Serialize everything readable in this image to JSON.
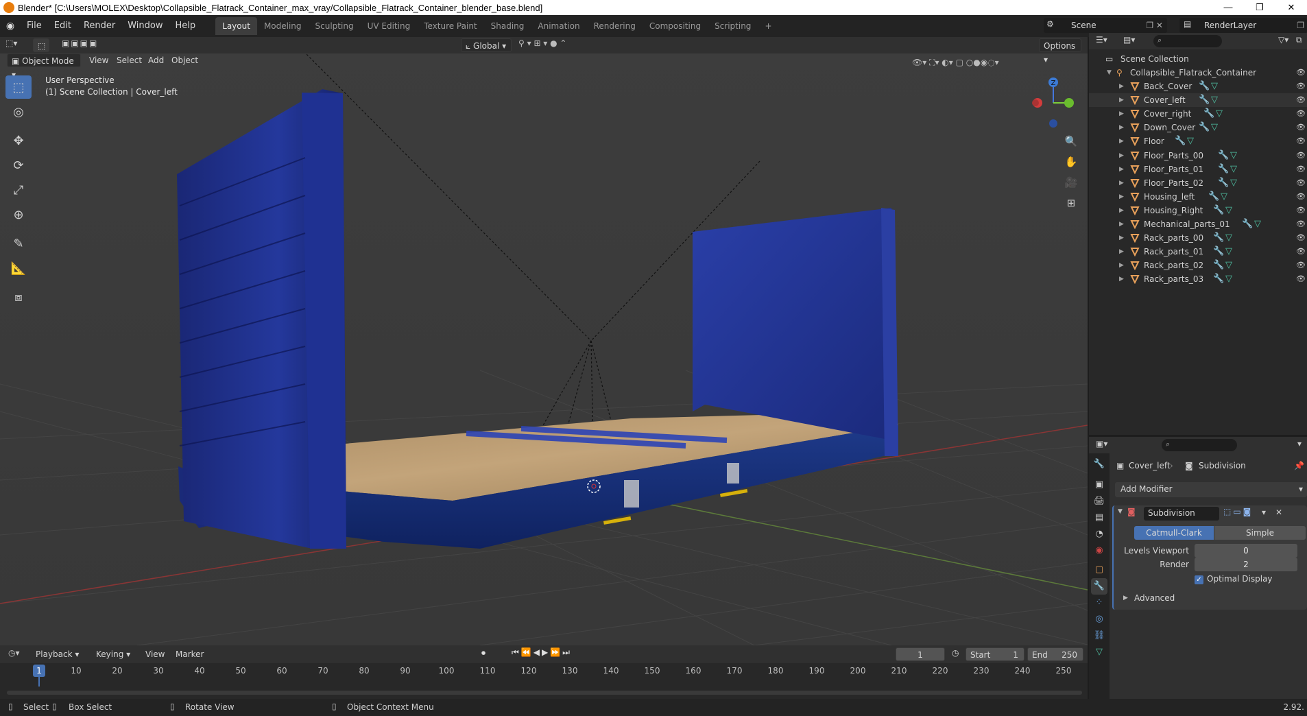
{
  "window": {
    "title": "Blender* [C:\\Users\\MOLEX\\Desktop\\Collapsible_Flatrack_Container_max_vray/Collapsible_Flatrack_Container_blender_base.blend]",
    "minimize": "—",
    "maximize": "❐",
    "close": "✕"
  },
  "menu": {
    "items": [
      "File",
      "Edit",
      "Render",
      "Window",
      "Help"
    ]
  },
  "workspaces": {
    "tabs": [
      "Layout",
      "Modeling",
      "Sculpting",
      "UV Editing",
      "Texture Paint",
      "Shading",
      "Animation",
      "Rendering",
      "Compositing",
      "Scripting"
    ],
    "add": "+",
    "active": "Layout"
  },
  "scene": {
    "scene_name": "Scene",
    "layer_name": "RenderLayer"
  },
  "viewport_header": {
    "mode": "Object Mode",
    "menus": [
      "View",
      "Select",
      "Add",
      "Object"
    ],
    "transform_orientation": "Global",
    "options": "Options"
  },
  "viewport": {
    "perspective": "User Perspective",
    "collection_info": "(1) Scene Collection | Cover_left",
    "gizmo_z": "Z"
  },
  "timeline": {
    "menus": [
      "Playback",
      "Keying",
      "View",
      "Marker"
    ],
    "current_frame": "1",
    "start_label": "Start",
    "start": "1",
    "end_label": "End",
    "end": "250",
    "ticks": [
      "1",
      "10",
      "20",
      "30",
      "40",
      "50",
      "60",
      "70",
      "80",
      "90",
      "100",
      "110",
      "120",
      "130",
      "140",
      "150",
      "160",
      "170",
      "180",
      "190",
      "200",
      "210",
      "220",
      "230",
      "240",
      "250"
    ]
  },
  "statusbar": {
    "select": "Select",
    "box_select": "Box Select",
    "rotate_view": "Rotate View",
    "context_menu": "Object Context Menu",
    "version": "2.92."
  },
  "outliner": {
    "root": "Scene Collection",
    "collection": "Collapsible_Flatrack_Container",
    "objects": [
      "Back_Cover",
      "Cover_left",
      "Cover_right",
      "Down_Cover",
      "Floor",
      "Floor_Parts_00",
      "Floor_Parts_01",
      "Floor_Parts_02",
      "Housing_left",
      "Housing_Right",
      "Mechanical_parts_01",
      "Rack_parts_00",
      "Rack_parts_01",
      "Rack_parts_02",
      "Rack_parts_03"
    ]
  },
  "properties": {
    "object": "Cover_left",
    "modifier_crumb": "Subdivision",
    "add_modifier": "Add Modifier",
    "modifier_name": "Subdivision",
    "algo_catmull": "Catmull-Clark",
    "algo_simple": "Simple",
    "levels_viewport_label": "Levels Viewport",
    "levels_viewport": "0",
    "render_label": "Render",
    "render": "2",
    "optimal_display": "Optimal Display",
    "advanced": "Advanced"
  },
  "colors": {
    "accent": "#4772b3",
    "container_blue": "#1e2f8c",
    "wood": "#b99a6e",
    "mesh_orange": "#e8a05a"
  }
}
